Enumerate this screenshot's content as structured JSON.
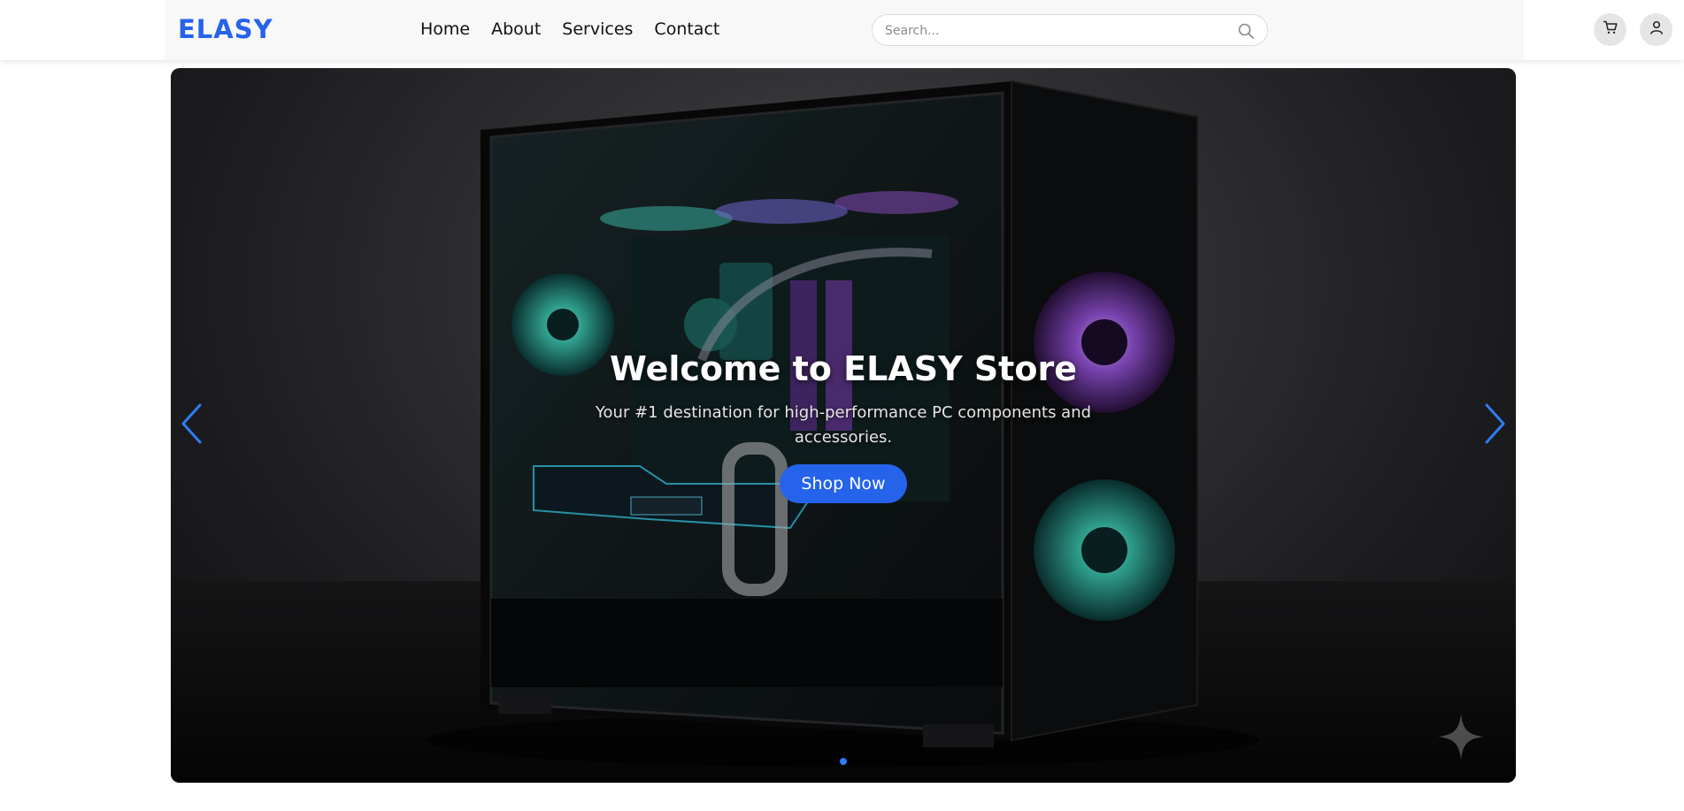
{
  "header": {
    "logo": "ELASY",
    "nav": [
      "Home",
      "About",
      "Services",
      "Contact"
    ],
    "search_placeholder": "Search...",
    "brand_color": "#2563eb",
    "icons": [
      "search-icon",
      "cart-icon",
      "user-icon"
    ]
  },
  "hero": {
    "title": "Welcome to ELASY Store",
    "subtitle": "Your #1 destination for high-performance PC components and accessories.",
    "cta_label": "Shop Now",
    "cta_color": "#2563eb",
    "carousel_arrow_color": "#2f7cf6",
    "active_slide": 1,
    "slide_count": 1
  }
}
